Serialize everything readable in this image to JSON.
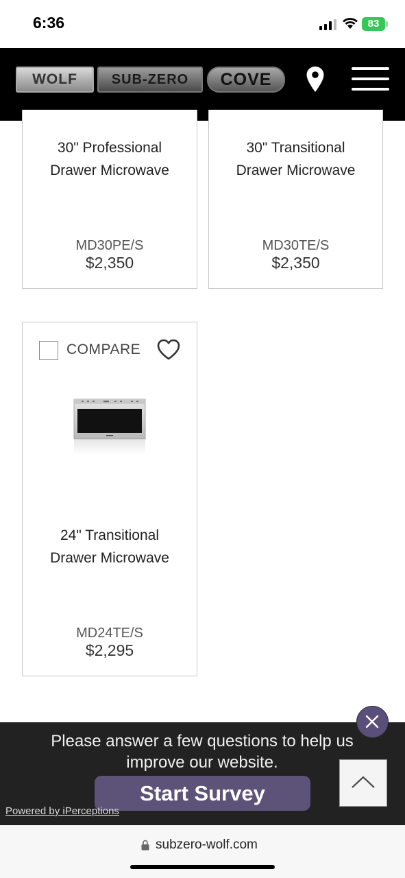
{
  "status_bar": {
    "time": "6:36",
    "battery": "83"
  },
  "header": {
    "brands": [
      "WOLF",
      "SUB-ZERO",
      "COVE"
    ],
    "icons": [
      "location-pin-icon",
      "hamburger-menu-icon"
    ]
  },
  "products": [
    {
      "name_line1": "30\" Professional",
      "name_line2": "Drawer Microwave",
      "model": "MD30PE/S",
      "price": "$2,350"
    },
    {
      "name_line1": "30\" Transitional",
      "name_line2": "Drawer Microwave",
      "model": "MD30TE/S",
      "price": "$2,350"
    },
    {
      "name_line1": "24\" Transitional",
      "name_line2": "Drawer Microwave",
      "model": "MD24TE/S",
      "price": "$2,295",
      "compare_label": "COMPARE"
    }
  ],
  "survey": {
    "message": "Please answer a few questions to help us improve our website.",
    "button_label": "Start Survey",
    "powered_by": "Powered by iPerceptions"
  },
  "browser": {
    "url": "subzero-wolf.com"
  },
  "colors": {
    "header_bg": "#000000",
    "survey_button": "#5d5378",
    "survey_bar": "#222222",
    "battery": "#34c759"
  }
}
